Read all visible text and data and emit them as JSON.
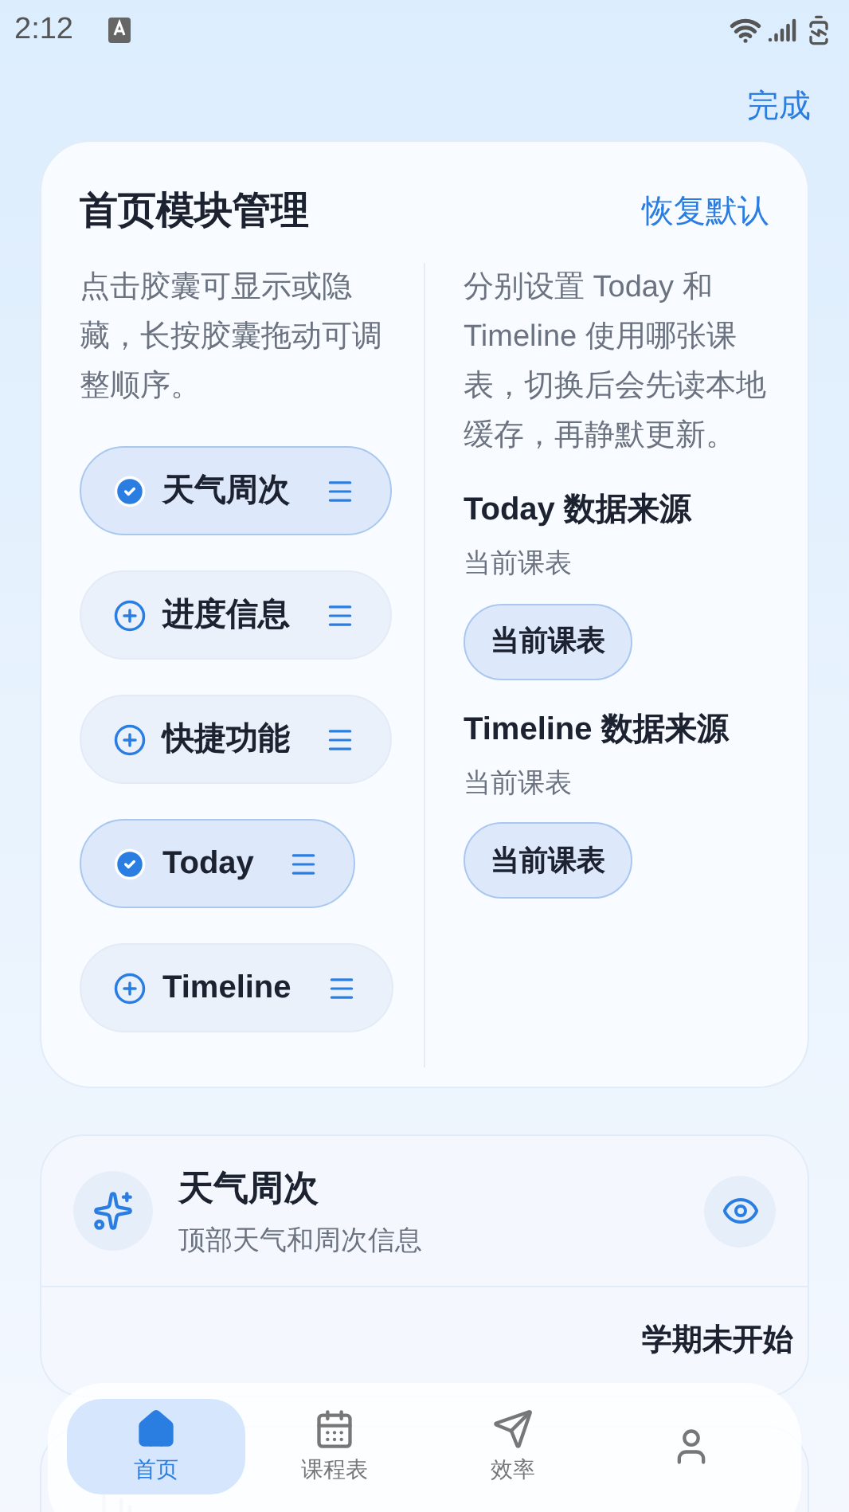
{
  "status_bar": {
    "time": "2:12"
  },
  "top_bar": {
    "done": "完成"
  },
  "manager": {
    "title": "首页模块管理",
    "reset": "恢复默认",
    "hint": "点击胶囊可显示或隐藏，长按胶囊拖动可调整顺序。",
    "chips": [
      {
        "label": "天气周次",
        "selected": true
      },
      {
        "label": "进度信息",
        "selected": false
      },
      {
        "label": "快捷功能",
        "selected": false
      },
      {
        "label": "Today",
        "selected": true
      },
      {
        "label": "Timeline",
        "selected": false
      }
    ],
    "source_hint": "分别设置 Today 和 Timeline 使用哪张课表，切换后会先读本地缓存，再静默更新。",
    "sources": [
      {
        "title": "Today 数据来源",
        "current": "当前课表",
        "button": "当前课表"
      },
      {
        "title": "Timeline 数据来源",
        "current": "当前课表",
        "button": "当前课表"
      }
    ]
  },
  "modules": [
    {
      "title": "天气周次",
      "subtitle": "顶部天气和周次信息",
      "visible": true,
      "status": "学期未开始"
    }
  ],
  "bottom_nav": [
    {
      "label": "首页",
      "selected": true
    },
    {
      "label": "课程表",
      "selected": false
    },
    {
      "label": "效率",
      "selected": false
    },
    {
      "selected": false
    }
  ]
}
